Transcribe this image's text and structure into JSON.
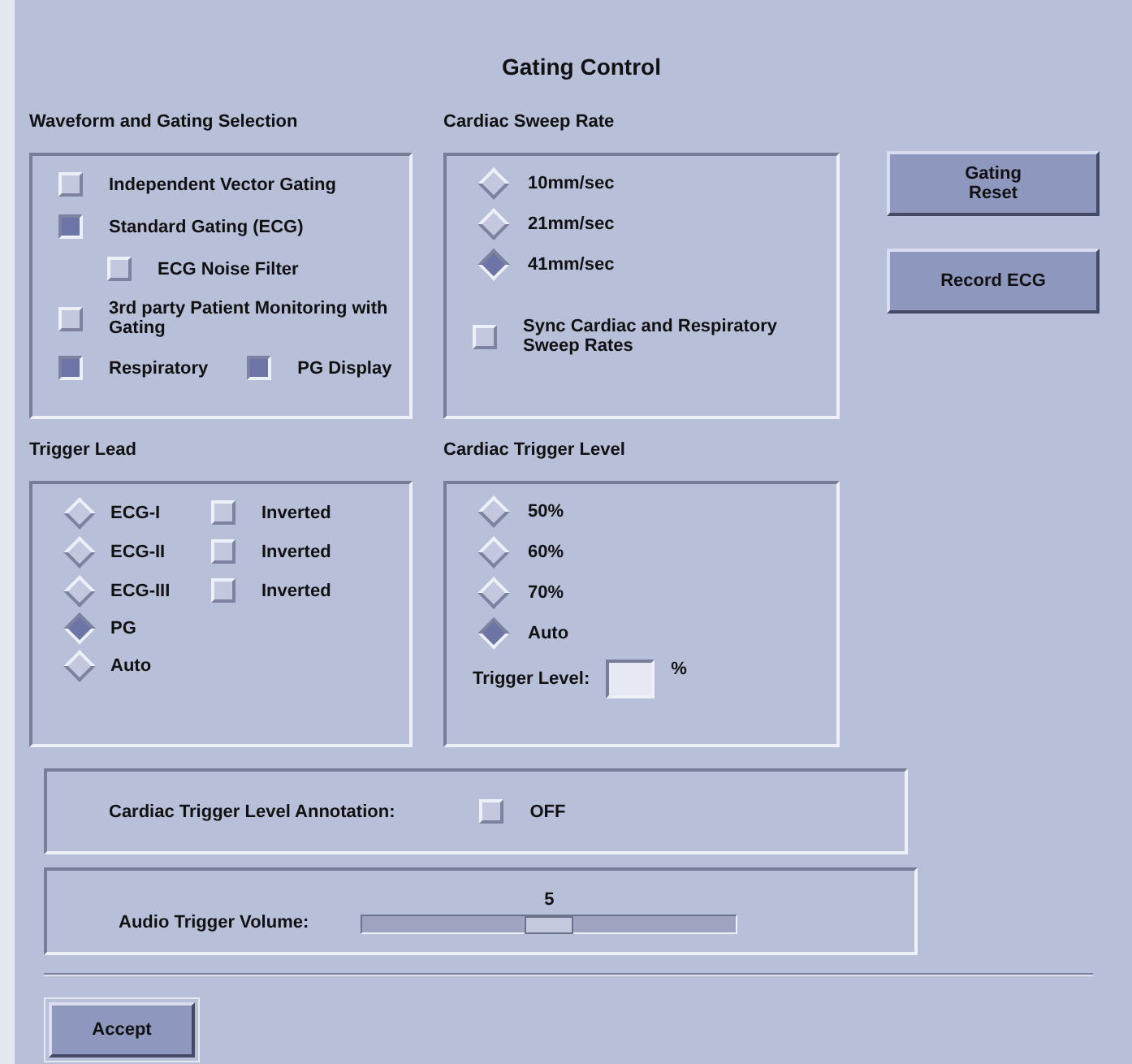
{
  "window": {
    "title": "Gating Control"
  },
  "waveform_gating": {
    "title": "Waveform and Gating Selection",
    "options": [
      {
        "label": "Independent Vector Gating",
        "checked": false
      },
      {
        "label": "Standard Gating (ECG)",
        "checked": true,
        "children": [
          {
            "label": "ECG Noise Filter",
            "checked": false
          }
        ]
      },
      {
        "label": "3rd party Patient Monitoring with Gating",
        "checked": false
      }
    ],
    "inline_options": [
      {
        "label": "Respiratory",
        "checked": true
      },
      {
        "label": "PG Display",
        "checked": true
      }
    ]
  },
  "sweep_rate": {
    "title": "Cardiac Sweep Rate",
    "options": [
      {
        "label": "10mm/sec",
        "selected": false
      },
      {
        "label": "21mm/sec",
        "selected": false
      },
      {
        "label": "41mm/sec",
        "selected": true
      }
    ],
    "sync": {
      "label": "Sync Cardiac and Respiratory Sweep Rates",
      "checked": false
    }
  },
  "buttons": [
    {
      "label": "Gating\nReset"
    },
    {
      "label": "Record ECG"
    }
  ],
  "trigger_lead": {
    "title": "Trigger Lead",
    "options": [
      {
        "label": "ECG-I",
        "selected": false,
        "inverted": {
          "label": "Inverted",
          "checked": false
        }
      },
      {
        "label": "ECG-II",
        "selected": false,
        "inverted": {
          "label": "Inverted",
          "checked": false
        }
      },
      {
        "label": "ECG-III",
        "selected": false,
        "inverted": {
          "label": "Inverted",
          "checked": false
        }
      },
      {
        "label": "PG",
        "selected": true
      },
      {
        "label": "Auto",
        "selected": false
      }
    ]
  },
  "trigger_level": {
    "title": "Cardiac Trigger Level",
    "options": [
      {
        "label": "50%",
        "selected": false
      },
      {
        "label": "60%",
        "selected": false
      },
      {
        "label": "70%",
        "selected": false
      },
      {
        "label": "Auto",
        "selected": true
      }
    ],
    "field": {
      "label": "Trigger Level:",
      "unit": "%"
    }
  },
  "annotation": {
    "label": "Cardiac Trigger Level Annotation:",
    "toggle": {
      "label": "OFF",
      "checked": false
    }
  },
  "volume": {
    "label": "Audio Trigger Volume:",
    "value": "5",
    "level": 0.5
  },
  "accept": {
    "label": "Accept"
  }
}
